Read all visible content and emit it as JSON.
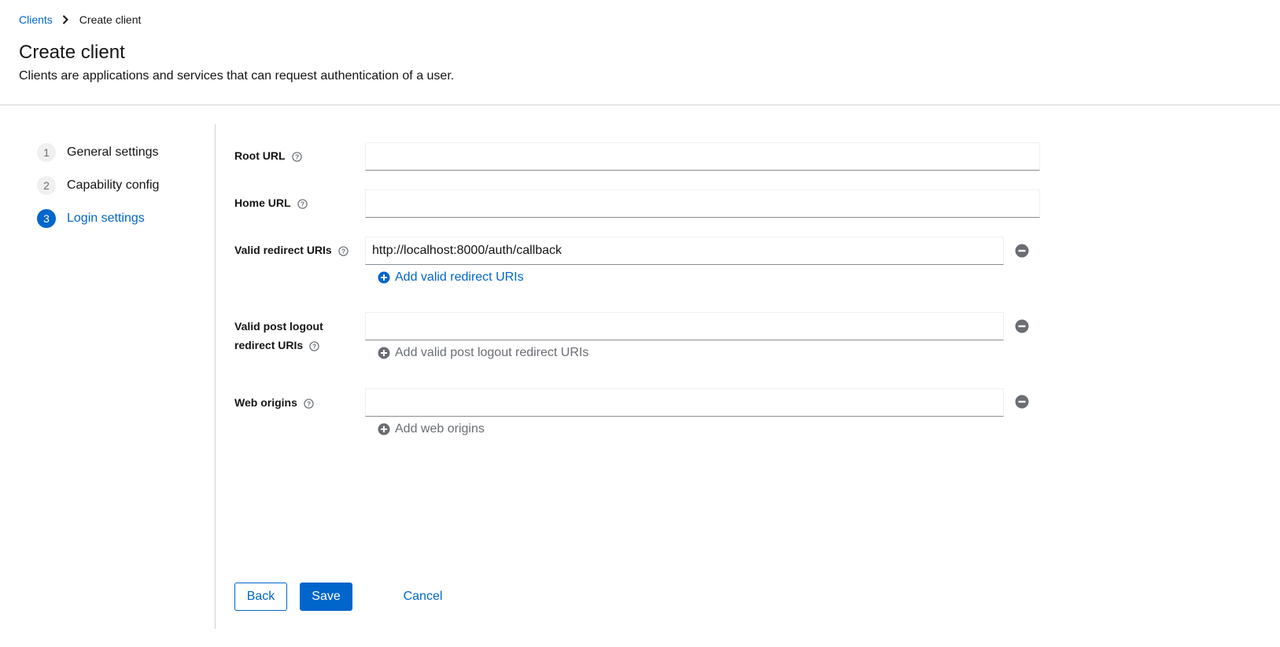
{
  "breadcrumb": {
    "parent": "Clients",
    "current": "Create client"
  },
  "header": {
    "title": "Create client",
    "description": "Clients are applications and services that can request authentication of a user."
  },
  "wizard": {
    "steps": [
      {
        "num": "1",
        "label": "General settings",
        "active": false
      },
      {
        "num": "2",
        "label": "Capability config",
        "active": false
      },
      {
        "num": "3",
        "label": "Login settings",
        "active": true
      }
    ]
  },
  "form": {
    "root_url": {
      "label": "Root URL",
      "value": ""
    },
    "home_url": {
      "label": "Home URL",
      "value": ""
    },
    "valid_redirect": {
      "label": "Valid redirect URIs",
      "value": "http://localhost:8000/auth/callback",
      "add_label": "Add valid redirect URIs"
    },
    "post_logout": {
      "label_line1": "Valid post logout",
      "label_line2": "redirect URIs",
      "value": "",
      "add_label": "Add valid post logout redirect URIs"
    },
    "web_origins": {
      "label": "Web origins",
      "value": "",
      "add_label": "Add web origins"
    }
  },
  "buttons": {
    "back": "Back",
    "save": "Save",
    "cancel": "Cancel"
  },
  "colors": {
    "accent": "#0066cc",
    "disabled": "#6a6e73",
    "border": "#d2d2d2"
  },
  "icons": {
    "help": "help-circle-icon",
    "remove": "minus-circle-icon",
    "add": "plus-circle-icon",
    "breadcrumb_sep": "chevron-right-icon"
  }
}
